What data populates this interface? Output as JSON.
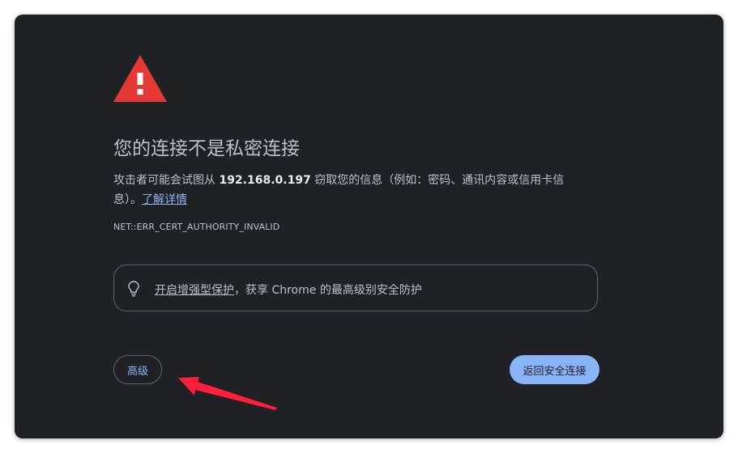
{
  "interstitial": {
    "title": "您的连接不是私密连接",
    "body_prefix": "攻击者可能会试图从 ",
    "host": "192.168.0.197",
    "body_suffix": " 窃取您的信息（例如：密码、通讯内容或信用卡信息）。",
    "learn_more": "了解详情",
    "error_code": "NET::ERR_CERT_AUTHORITY_INVALID",
    "promo_link": "开启增强型保护",
    "promo_rest": "，获享 Chrome 的最高级别安全防护",
    "advanced_button": "高级",
    "back_button": "返回安全连接"
  },
  "icons": {
    "warning": "warning-triangle-icon",
    "bulb": "lightbulb-icon",
    "annotation": "red-arrow-annotation"
  },
  "colors": {
    "background": "#202124",
    "text": "#bdc1c6",
    "accent": "#8ab4f8",
    "warning_red": "#e53935",
    "annotation_red": "#ff1f3d"
  }
}
